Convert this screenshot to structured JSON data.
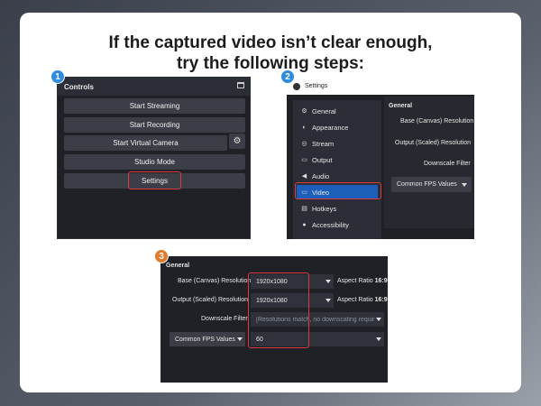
{
  "headline": {
    "line1": "If the captured video isn’t clear enough,",
    "line2": "try the following steps:"
  },
  "badges": [
    "1",
    "2",
    "3"
  ],
  "controls": {
    "title": "Controls",
    "buttons": {
      "start_streaming": "Start Streaming",
      "start_recording": "Start Recording",
      "start_virtual_camera": "Start Virtual Camera",
      "studio_mode": "Studio Mode",
      "settings": "Settings"
    }
  },
  "settings_window": {
    "title": "Settings",
    "sidebar": [
      "General",
      "Appearance",
      "Stream",
      "Output",
      "Audio",
      "Video",
      "Hotkeys",
      "Accessibility"
    ],
    "selected": "Video",
    "section_title": "General",
    "labels": {
      "base": "Base (Canvas) Resolution",
      "output": "Output (Scaled) Resolution",
      "downscale": "Downscale Filter"
    },
    "fps_combo": "Common FPS Values"
  },
  "video_settings": {
    "section_title": "General",
    "base_label": "Base (Canvas) Resolution",
    "base_value": "1920x1080",
    "base_aspect_prefix": "Aspect Ratio",
    "base_aspect_value": "16:9",
    "output_label": "Output (Scaled) Resolution",
    "output_value": "1920x1080",
    "output_aspect_prefix": "Aspect Ratio",
    "output_aspect_value": "16:9",
    "downscale_label": "Downscale Filter",
    "downscale_value": "[Resolutions match, no downscaling requir",
    "fps_combo": "Common FPS Values",
    "fps_value": "60"
  },
  "colors": {
    "highlight": "#e0393a",
    "badge_blue": "#2f8be0",
    "badge_orange": "#e37a2c",
    "selected_item": "#1b5fba"
  }
}
